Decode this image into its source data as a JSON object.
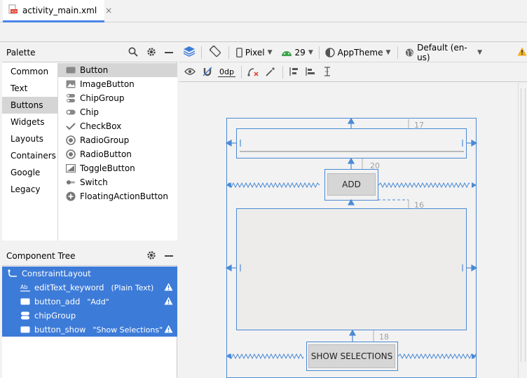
{
  "editor_tab": {
    "filename": "activity_main.xml",
    "close": "×"
  },
  "palette": {
    "title": "Palette",
    "categories": [
      "Common",
      "Text",
      "Buttons",
      "Widgets",
      "Layouts",
      "Containers",
      "Google",
      "Legacy"
    ],
    "selected_category": "Buttons",
    "widgets": [
      {
        "label": "Button",
        "icon": "button-icon"
      },
      {
        "label": "ImageButton",
        "icon": "image-button-icon"
      },
      {
        "label": "ChipGroup",
        "icon": "chip-group-icon"
      },
      {
        "label": "Chip",
        "icon": "chip-icon"
      },
      {
        "label": "CheckBox",
        "icon": "checkbox-icon"
      },
      {
        "label": "RadioGroup",
        "icon": "radio-group-icon"
      },
      {
        "label": "RadioButton",
        "icon": "radio-button-icon"
      },
      {
        "label": "ToggleButton",
        "icon": "toggle-button-icon"
      },
      {
        "label": "Switch",
        "icon": "switch-icon"
      },
      {
        "label": "FloatingActionButton",
        "icon": "fab-icon"
      }
    ],
    "selected_widget": "Button"
  },
  "component_tree": {
    "title": "Component Tree",
    "root": "ConstraintLayout",
    "items": [
      {
        "name": "editText_keyword",
        "extra": "(Plain Text)",
        "warning": true
      },
      {
        "name": "button_add",
        "extra": "\"Add\"",
        "warning": true
      },
      {
        "name": "chipGroup",
        "extra": "",
        "warning": false
      },
      {
        "name": "button_show",
        "extra": "\"Show Selections\"",
        "warning": true
      }
    ]
  },
  "toolbar": {
    "device": "Pixel",
    "api": "29",
    "theme": "AppTheme",
    "locale": "Default (en-us)",
    "margin": "0dp"
  },
  "design": {
    "add_button": "ADD",
    "show_button": "SHOW SELECTIONS",
    "margins": [
      "17",
      "20",
      "16",
      "18"
    ]
  },
  "colors": {
    "selection_blue": "#3d7bd8",
    "blueprint_blue": "#4a8ad6",
    "warning_yellow": "#f2b01e"
  }
}
